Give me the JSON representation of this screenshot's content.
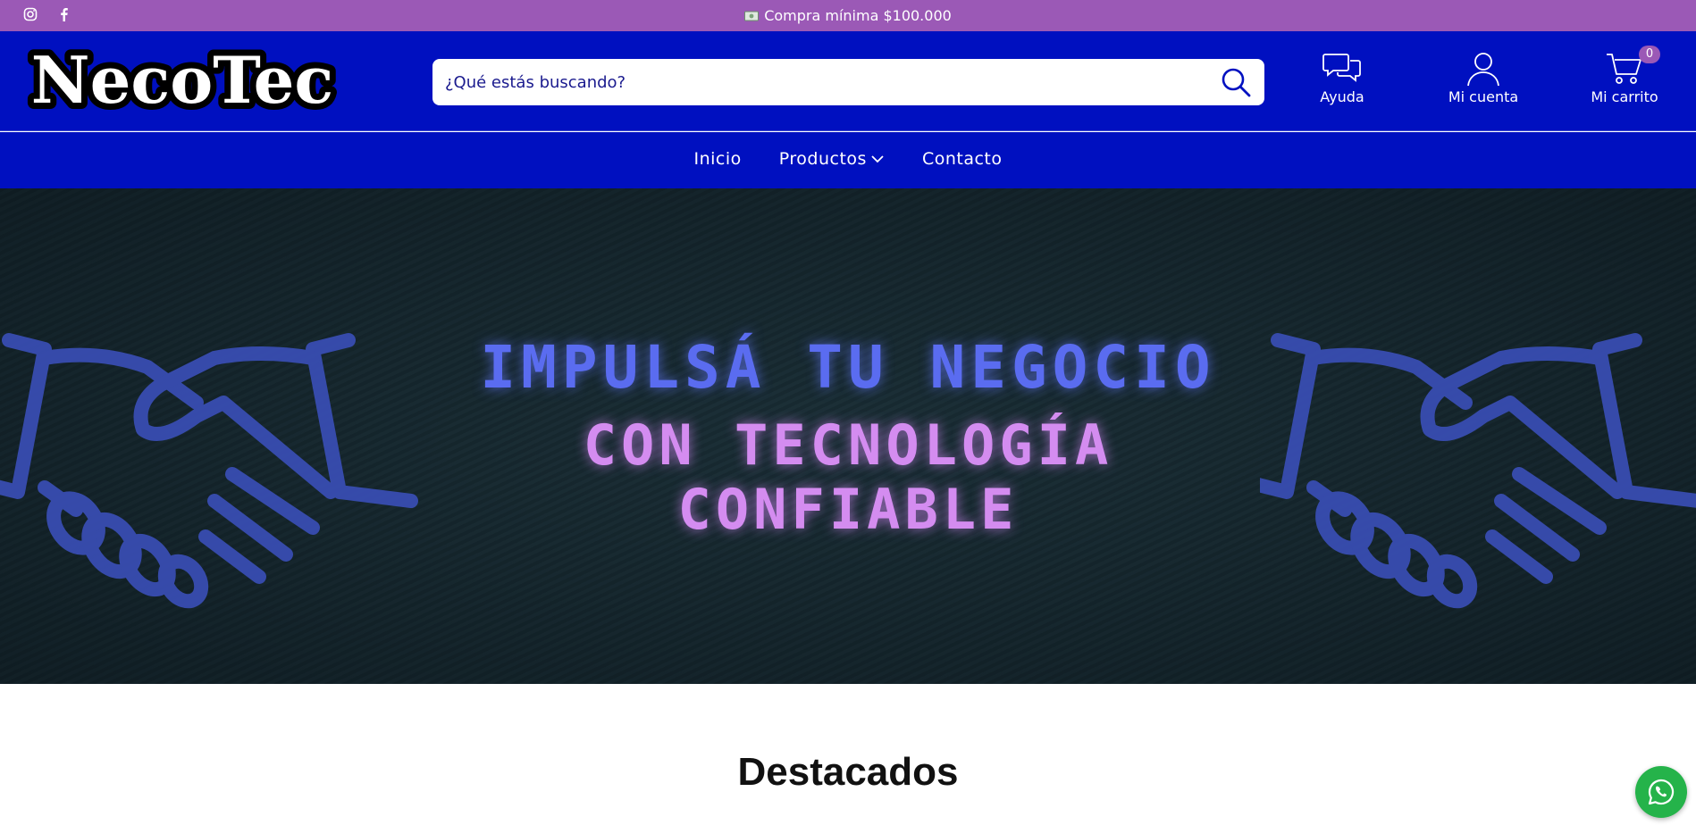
{
  "topbar": {
    "promo_text": "Compra mínima $100.000",
    "social_icons": [
      "instagram-icon",
      "facebook-icon"
    ],
    "promo_icon": "money-icon",
    "background": "#9b59b6"
  },
  "header": {
    "logo_text": "NecoTec",
    "search": {
      "placeholder": "¿Qué estás buscando?",
      "value": ""
    },
    "help_label": "Ayuda",
    "account_label": "Mi cuenta",
    "cart_label": "Mi carrito",
    "cart_count": "0",
    "background": "#0010c0"
  },
  "nav": {
    "items": [
      {
        "label": "Inicio"
      },
      {
        "label": "Productos"
      },
      {
        "label": "Contacto"
      }
    ]
  },
  "hero": {
    "line1": "IMPULSÁ TU NEGOCIO",
    "line2a": "CON TECNOLOGÍA",
    "line2b": "CONFIABLE",
    "accent_blue": "#5a6cf0",
    "accent_purple": "#d48cf0"
  },
  "featured": {
    "title": "Destacados"
  },
  "whatsapp": {
    "icon": "whatsapp-icon",
    "color": "#25b34a"
  }
}
